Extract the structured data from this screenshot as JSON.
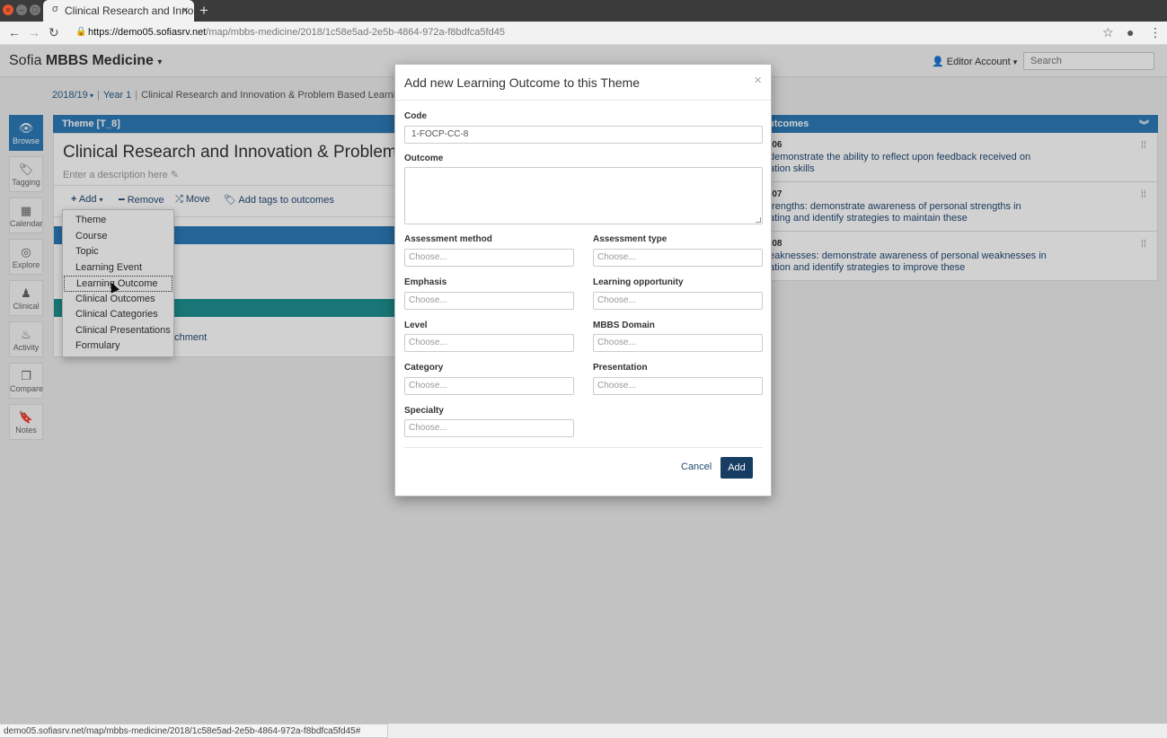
{
  "browser": {
    "tab_title": "Clinical Research and Inno",
    "tab_close": "×",
    "new_tab": "+",
    "url_host": "https://demo05.sofiasrv.net",
    "url_path": "/map/mbbs-medicine/2018/1c58e5ad-2e5b-4864-972a-f8bdfca5fd45",
    "status_url": "demo05.sofiasrv.net/map/mbbs-medicine/2018/1c58e5ad-2e5b-4864-972a-f8bdfca5fd45#"
  },
  "app": {
    "brand_light": "Sofia",
    "brand_bold": "MBBS Medicine",
    "account": "Editor Account",
    "search_placeholder": "Search"
  },
  "breadcrumbs": {
    "year": "2018/19",
    "level": "Year 1",
    "current": "Clinical Research and Innovation & Problem Based Learning"
  },
  "sidenav": [
    {
      "label": "Browse",
      "icon": "eye-icon"
    },
    {
      "label": "Tagging",
      "icon": "tags-icon"
    },
    {
      "label": "Calendar",
      "icon": "calendar-icon"
    },
    {
      "label": "Explore",
      "icon": "compass-icon"
    },
    {
      "label": "Clinical",
      "icon": "user-icon"
    },
    {
      "label": "Activity",
      "icon": "fire-icon"
    },
    {
      "label": "Compare",
      "icon": "copy-icon"
    },
    {
      "label": "Notes",
      "icon": "bookmark-icon"
    }
  ],
  "theme": {
    "header": "Theme [T_8]",
    "title": "Clinical Research and Innovation & Problem Base",
    "description_placeholder": "Enter a description here",
    "toolbar": {
      "add": "Add",
      "remove": "Remove",
      "move": "Move",
      "tags": "Add tags to outcomes"
    },
    "attachment_link": "achment"
  },
  "add_menu": [
    "Theme",
    "Course",
    "Topic",
    "Learning Event",
    "Learning Outcome",
    "Clinical Outcomes",
    "Clinical Categories",
    "Clinical Presentations",
    "Formulary"
  ],
  "outcomes": {
    "header": "utcomes",
    "rows": [
      {
        "code": "-06",
        "line1": "demonstrate the ability to reflect upon feedback received on",
        "line2": "ation skills"
      },
      {
        "code": "-07",
        "line1": "trengths: demonstrate awareness of personal strengths in",
        "line2": "ating and identify strategies to maintain these"
      },
      {
        "code": "-08",
        "line1": "eaknesses: demonstrate awareness of personal weaknesses in",
        "line2": "ation and identify strategies to improve these"
      }
    ]
  },
  "modal": {
    "title": "Add new Learning Outcome to this Theme",
    "close": "×",
    "code_label": "Code",
    "code_value": "1-FOCP-CC-8",
    "outcome_label": "Outcome",
    "choose": "Choose...",
    "fields": {
      "assessment_method": "Assessment method",
      "assessment_type": "Assessment type",
      "emphasis": "Emphasis",
      "learning_opportunity": "Learning opportunity",
      "level": "Level",
      "mbbs_domain": "MBBS Domain",
      "category": "Category",
      "presentation": "Presentation",
      "specialty": "Specialty"
    },
    "cancel": "Cancel",
    "add": "Add"
  }
}
